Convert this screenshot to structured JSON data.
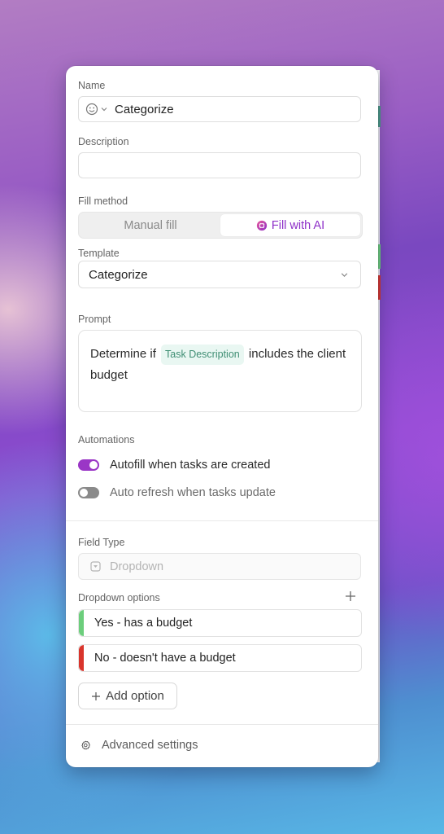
{
  "panel": {
    "name": {
      "label": "Name",
      "value": "Categorize",
      "icon": "emoji-smiley-icon"
    },
    "description": {
      "label": "Description",
      "value": "",
      "placeholder": ""
    },
    "fill_method": {
      "label": "Fill method",
      "options": [
        {
          "label": "Manual fill",
          "selected": false
        },
        {
          "label": "Fill with AI",
          "selected": true,
          "icon": "ai-brain-icon"
        }
      ],
      "accent_color": "#8e2fc8"
    },
    "template": {
      "label": "Template",
      "value": "Categorize"
    },
    "prompt": {
      "label": "Prompt",
      "text_before": "Determine if",
      "chip": "Task Description",
      "text_after": "includes the client budget"
    },
    "automations": {
      "label": "Automations",
      "items": [
        {
          "label": "Autofill when tasks are created",
          "enabled": true
        },
        {
          "label": "Auto refresh when tasks update",
          "enabled": false
        }
      ]
    },
    "field_type": {
      "label": "Field Type",
      "value": "Dropdown",
      "icon": "dropdown-icon",
      "disabled": true
    },
    "dropdown_options": {
      "label": "Dropdown options",
      "items": [
        {
          "label": "Yes - has a budget",
          "color": "#6cce7c"
        },
        {
          "label": "No - doesn't have a budget",
          "color": "#d9352c"
        }
      ],
      "add_label": "Add option"
    },
    "advanced_settings_label": "Advanced settings"
  }
}
